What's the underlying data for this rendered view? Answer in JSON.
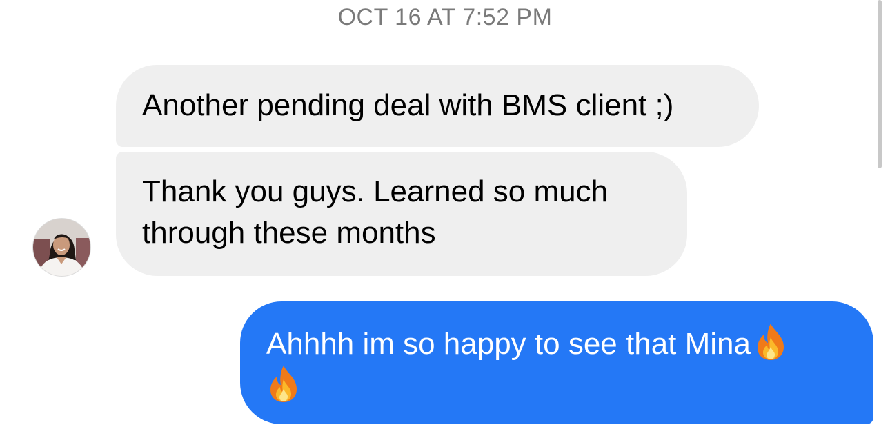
{
  "conversation": {
    "timestamp": "OCT 16 AT 7:52 PM",
    "messages": [
      {
        "sender": "contact",
        "text": "Another pending deal with BMS client ;)"
      },
      {
        "sender": "contact",
        "text": "Thank you guys. Learned so much through these months"
      },
      {
        "sender": "self",
        "text": "Ahhhh im so happy to see that Mina",
        "trailing_emoji": [
          "fire-emoji",
          "fire-emoji"
        ]
      }
    ]
  },
  "colors": {
    "incoming_bubble": "#efefef",
    "outgoing_bubble": "#2478f6",
    "timestamp": "#7a7a7a"
  }
}
